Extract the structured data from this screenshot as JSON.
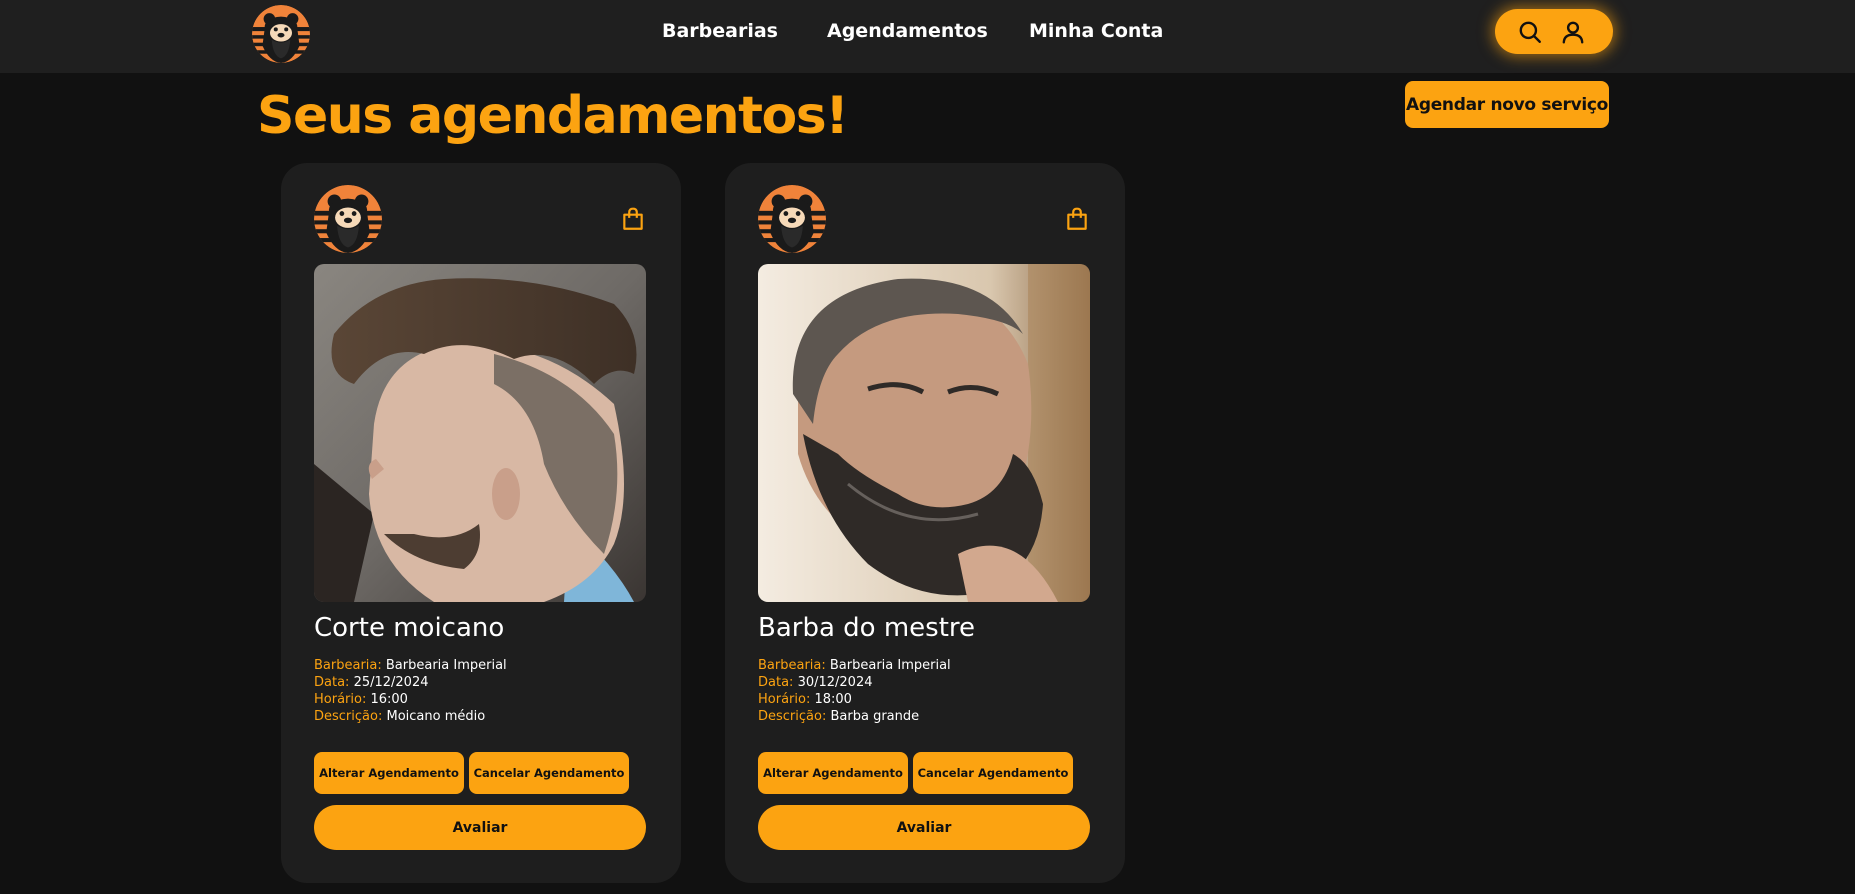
{
  "header": {
    "nav": [
      {
        "label": "Barbearias"
      },
      {
        "label": "Agendamentos"
      },
      {
        "label": "Minha Conta"
      }
    ]
  },
  "main": {
    "title": "Seus agendamentos!",
    "new_service_label": "Agendar novo serviço"
  },
  "appointments": [
    {
      "service": "Corte moicano",
      "barbershop_label": "Barbearia:",
      "barbershop": "Barbearia Imperial",
      "date_label": "Data:",
      "date": "25/12/2024",
      "time_label": "Horário:",
      "time": "16:00",
      "description_label": "Descrição:",
      "description": "Moicano médio",
      "change_label": "Alterar Agendamento",
      "cancel_label": "Cancelar Agendamento",
      "rate_label": "Avaliar"
    },
    {
      "service": "Barba do mestre",
      "barbershop_label": "Barbearia:",
      "barbershop": "Barbearia Imperial",
      "date_label": "Data:",
      "date": "30/12/2024",
      "time_label": "Horário:",
      "time": "18:00",
      "description_label": "Descrição:",
      "description": "Barba grande",
      "change_label": "Alterar Agendamento",
      "cancel_label": "Cancelar Agendamento",
      "rate_label": "Avaliar"
    }
  ],
  "icons": {
    "logo": "bear-barber-logo",
    "search": "search-icon",
    "user": "user-icon",
    "bag": "shopping-bag-icon"
  },
  "colors": {
    "accent": "#fca311",
    "background": "#111111",
    "header": "#1f1f1f",
    "card": "#1e1e1e"
  }
}
